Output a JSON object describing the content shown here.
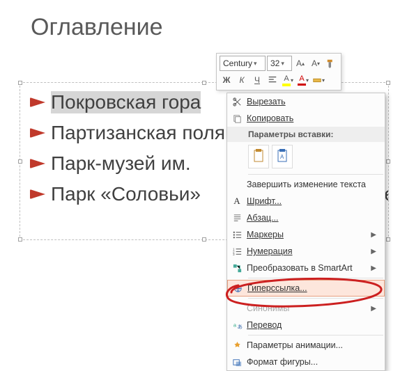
{
  "slide": {
    "title": "Оглавление",
    "list": [
      "Покровская гора",
      "Партизанская поляна",
      "Парк-музей им.",
      "Парк «Соловьи»"
    ],
    "trailing_fragment": "сме"
  },
  "mini_toolbar": {
    "font_name": "Century",
    "font_size": "32"
  },
  "context_menu": {
    "cut": "Вырезать",
    "copy": "Копировать",
    "paste_header": "Параметры вставки:",
    "finish_edit": "Завершить изменение текста",
    "font": "Шрифт...",
    "paragraph": "Абзац...",
    "bullets": "Маркеры",
    "numbering": "Нумерация",
    "smartart": "Преобразовать в SmartArt",
    "hyperlink": "Гиперссылка...",
    "synonyms": "Синонимы",
    "translate": "Перевод",
    "anim": "Параметры анимации...",
    "format_shape": "Формат фигуры..."
  }
}
